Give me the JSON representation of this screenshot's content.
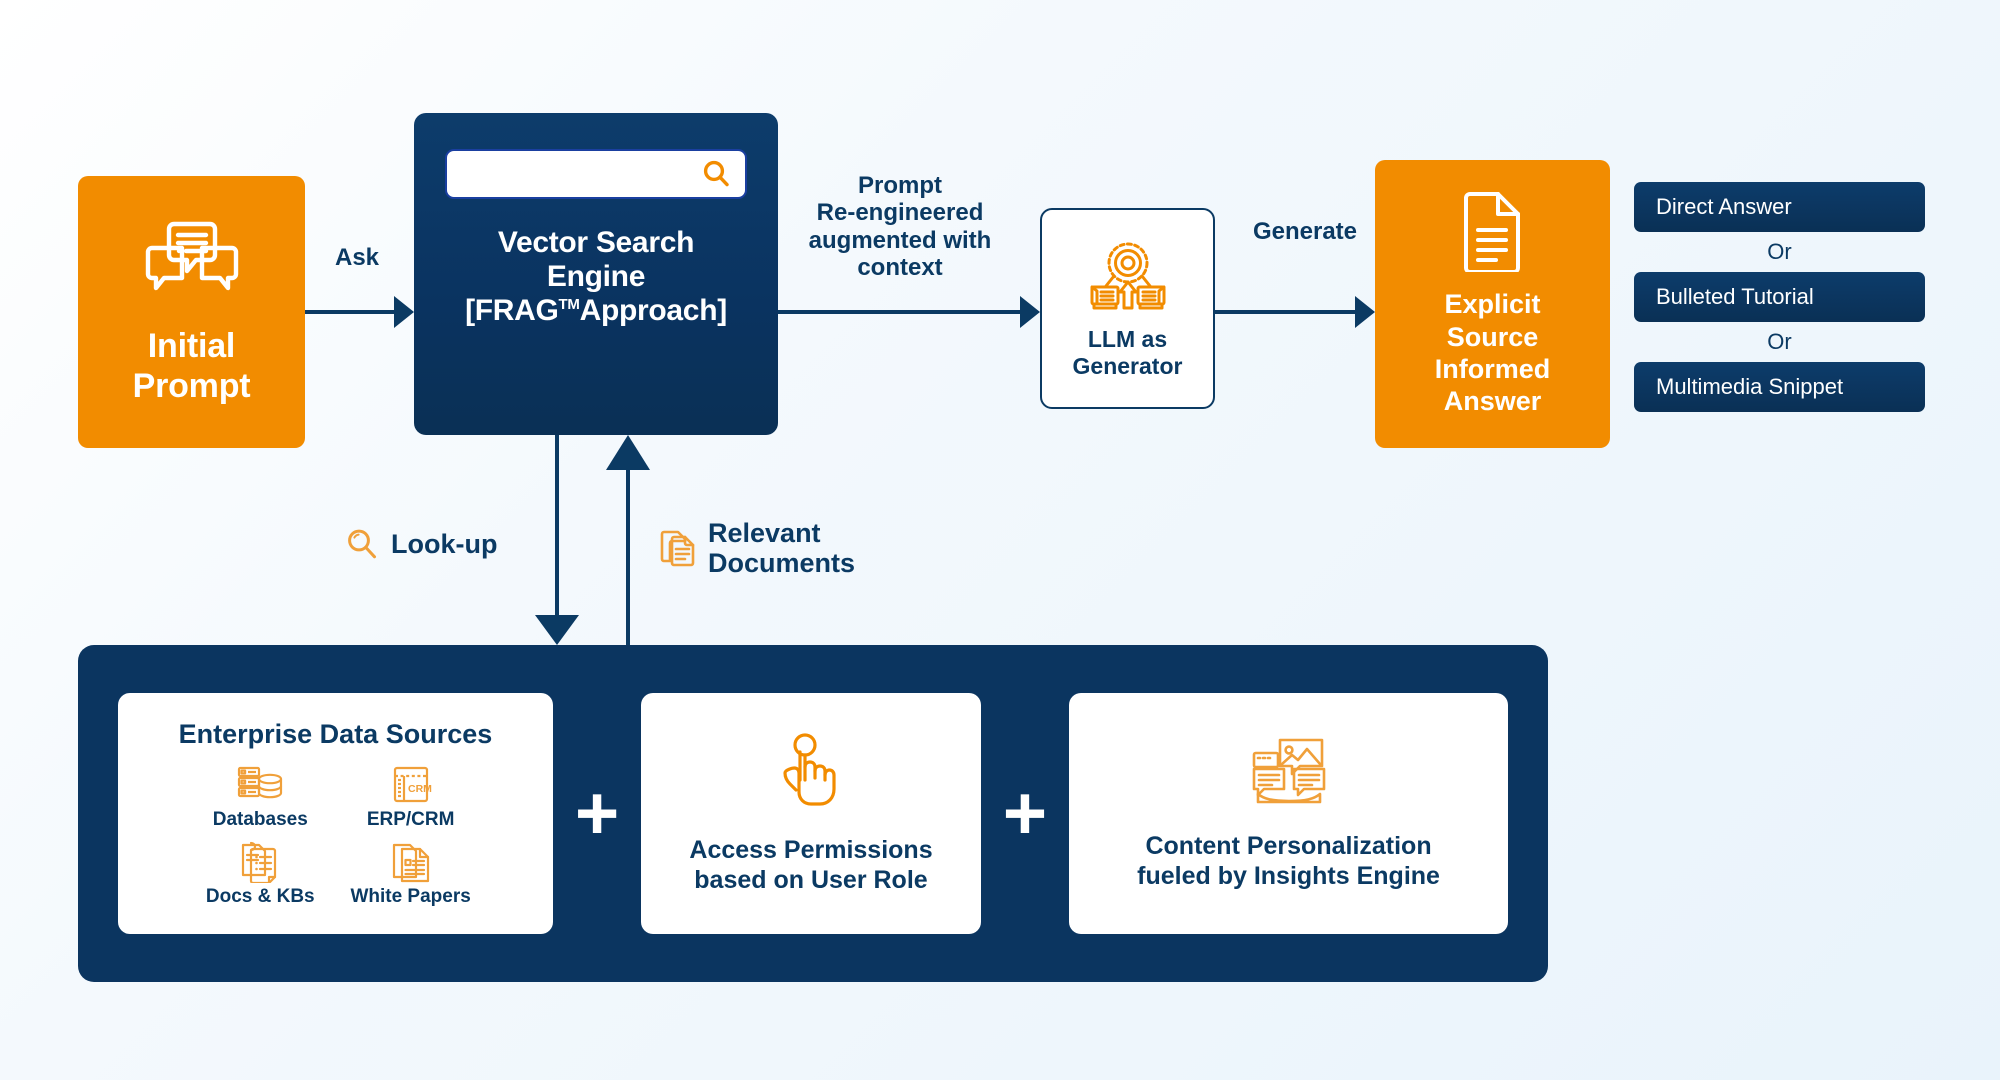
{
  "colors": {
    "orange": "#F28C00",
    "navy": "#0B3560",
    "navy_text": "#0B3A63",
    "background": "#F2F8FD",
    "white": "#FFFFFF"
  },
  "flow": {
    "initial_prompt": {
      "icon": "chat-bubbles-icon",
      "label": "Initial\nPrompt",
      "line1": "Initial",
      "line2": "Prompt"
    },
    "edge_ask": "Ask",
    "vector_engine": {
      "search_icon": "search-magnifier-icon",
      "search_value": "",
      "title_line1": "Vector Search",
      "title_line2": "Engine",
      "title_line3_pre": "[FRAG",
      "title_line3_sup": "TM",
      "title_line3_post": "Approach]"
    },
    "edge_prompt_reengineered": "Prompt\nRe-engineered\naugmented with\ncontext",
    "edge_prompt_lines": [
      "Prompt",
      "Re-engineered",
      "augmented with",
      "context"
    ],
    "llm": {
      "icon": "gear-generator-icon",
      "line1": "LLM as",
      "line2": "Generator"
    },
    "edge_generate": "Generate",
    "explicit_answer": {
      "icon": "document-lines-icon",
      "line1": "Explicit",
      "line2": "Source",
      "line3": "Informed",
      "line4": "Answer"
    },
    "edge_lookup": {
      "icon": "search-magnifier-icon",
      "label": "Look-up"
    },
    "edge_relevant_documents": {
      "icon": "documents-stack-icon",
      "line1": "Relevant",
      "line2": "Documents"
    }
  },
  "output_options": {
    "items": [
      {
        "label": "Direct Answer"
      },
      {
        "label": "Bulleted Tutorial"
      },
      {
        "label": "Multimedia Snippet"
      }
    ],
    "separator": "Or"
  },
  "foundation": {
    "plus": "+",
    "data_sources": {
      "title": "Enterprise Data Sources",
      "items": [
        {
          "icon": "database-server-icon",
          "name": "Databases"
        },
        {
          "icon": "crm-window-icon",
          "name": "ERP/CRM"
        },
        {
          "icon": "docs-kb-icon",
          "name": "Docs & KBs"
        },
        {
          "icon": "white-paper-icon",
          "name": "White Papers"
        }
      ]
    },
    "access_permissions": {
      "icon": "pointing-hand-icon",
      "line1": "Access Permissions",
      "line2": "based on User Role"
    },
    "content_personalization": {
      "icon": "content-personalization-icon",
      "line1": "Content Personalization",
      "line2": "fueled by Insights Engine"
    }
  }
}
